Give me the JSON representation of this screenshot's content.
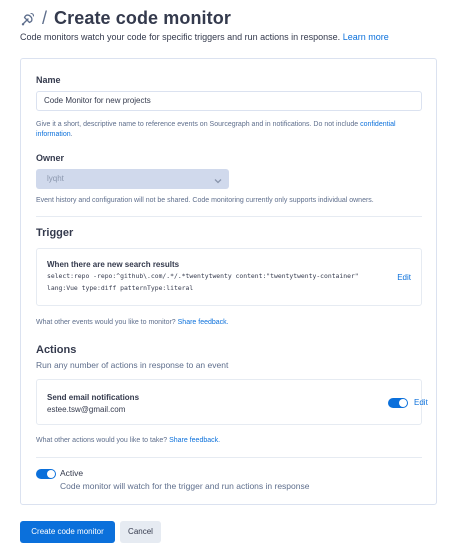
{
  "header": {
    "logo_icon": "code-monitoring-icon",
    "separator": "/",
    "title": "Create code monitor",
    "subtitle": "Code monitors watch your code for specific triggers and run actions in response.",
    "learn_more": "Learn more"
  },
  "name_section": {
    "label": "Name",
    "value": "Code Monitor for new projects",
    "help": "Give it a short, descriptive name to reference events on Sourcegraph and in notifications. Do not include",
    "help_link_1": "confidential",
    "help_link_2": "information",
    "help_tail": "."
  },
  "owner_section": {
    "label": "Owner",
    "selected": "lyqht",
    "help": "Event history and configuration will not be shared. Code monitoring currently only supports individual owners."
  },
  "trigger": {
    "heading": "Trigger",
    "title": "When there are new search results",
    "query_line_1": "select:repo -repo:^github\\.com/.*/.*twentytwenty content:\"twentytwenty-container\"",
    "query_line_2": "lang:Vue type:diff patternType:literal",
    "edit": "Edit",
    "feedback_prompt": "What other events would you like to monitor?",
    "feedback_link": "Share feedback."
  },
  "actions": {
    "heading": "Actions",
    "description": "Run any number of actions in response to an event",
    "email_title": "Send email notifications",
    "email_address": "estee.tsw@gmail.com",
    "email_enabled": true,
    "edit": "Edit",
    "feedback_prompt": "What other actions would you like to take?",
    "feedback_link": "Share feedback."
  },
  "active": {
    "label": "Active",
    "enabled": true,
    "description": "Code monitor will watch for the trigger and run actions in response"
  },
  "buttons": {
    "create": "Create code monitor",
    "cancel": "Cancel"
  },
  "colors": {
    "primary": "#0b70db",
    "text": "#343a4d",
    "muted": "#5e6e8c",
    "border": "#dbe2f0"
  }
}
